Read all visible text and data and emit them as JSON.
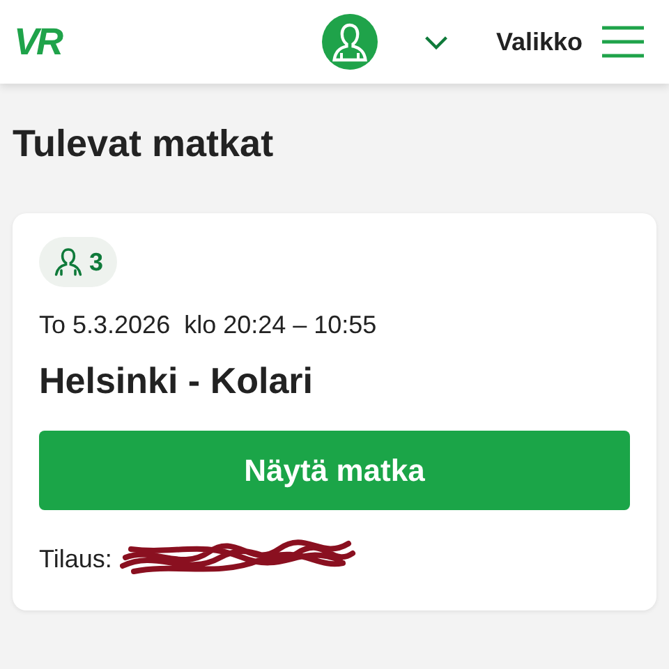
{
  "header": {
    "logo": "VR",
    "menu_label": "Valikko"
  },
  "page_title": "Tulevat matkat",
  "trips": [
    {
      "passengers": "3",
      "date": "To 5.3.2026",
      "time": "klo 20:24 – 10:55",
      "route": "Helsinki - Kolari",
      "button": "Näytä matka",
      "order_label": "Tilaus:",
      "order_redacted": true
    }
  ]
}
